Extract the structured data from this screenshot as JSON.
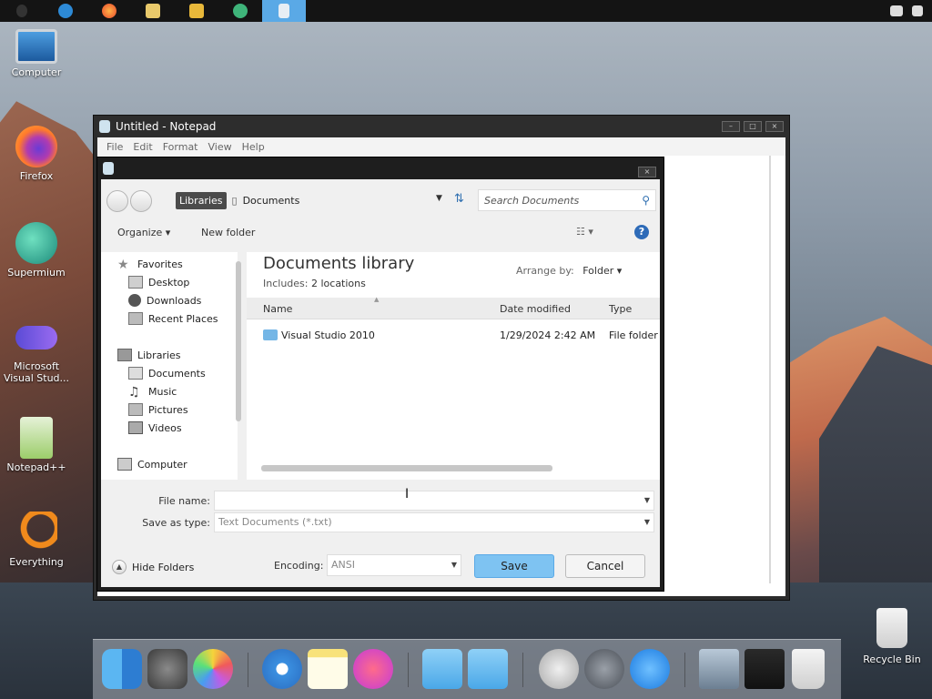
{
  "taskbar": {
    "buttons": [
      "mac-menu-icon",
      "ie-icon",
      "firefox-icon",
      "explorer-icon",
      "media-icon",
      "supermium-icon",
      "notepad-icon"
    ],
    "active": "notepad-icon"
  },
  "desktop": {
    "icons": [
      {
        "name": "computer",
        "label": "Computer"
      },
      {
        "name": "firefox",
        "label": "Firefox"
      },
      {
        "name": "supermium",
        "label": "Supermium"
      },
      {
        "name": "visual-studio",
        "label": "Microsoft Visual Stud..."
      },
      {
        "name": "notepadpp",
        "label": "Notepad++"
      },
      {
        "name": "everything",
        "label": "Everything"
      }
    ],
    "recycle_bin": "Recycle Bin"
  },
  "notepad": {
    "title": "Untitled - Notepad",
    "menu": [
      "File",
      "Edit",
      "Format",
      "View",
      "Help"
    ]
  },
  "dialog": {
    "breadcrumb": {
      "root": "Libraries",
      "current": "Documents"
    },
    "search_placeholder": "Search Documents",
    "toolbar": {
      "organize": "Organize",
      "new_folder": "New folder"
    },
    "nav": {
      "favorites": "Favorites",
      "favorites_items": [
        "Desktop",
        "Downloads",
        "Recent Places"
      ],
      "libraries": "Libraries",
      "libraries_items": [
        "Documents",
        "Music",
        "Pictures",
        "Videos"
      ],
      "computer": "Computer"
    },
    "content": {
      "title": "Documents library",
      "includes_label": "Includes:",
      "includes_value": "2 locations",
      "arrange_label": "Arrange by:",
      "arrange_value": "Folder",
      "columns": [
        "Name",
        "Date modified",
        "Type"
      ],
      "rows": [
        {
          "name": "Visual Studio 2010",
          "date": "1/29/2024 2:42 AM",
          "type": "File folder"
        }
      ]
    },
    "file_name_label": "File name:",
    "file_name_value": "",
    "save_type_label": "Save as type:",
    "save_type_value": "Text Documents (*.txt)",
    "hide_folders": "Hide Folders",
    "encoding_label": "Encoding:",
    "encoding_value": "ANSI",
    "save_button": "Save",
    "cancel_button": "Cancel"
  },
  "colors": {
    "accent": "#5aa9e6",
    "save_button": "#7ec3f2",
    "taskbar": "#141414"
  }
}
